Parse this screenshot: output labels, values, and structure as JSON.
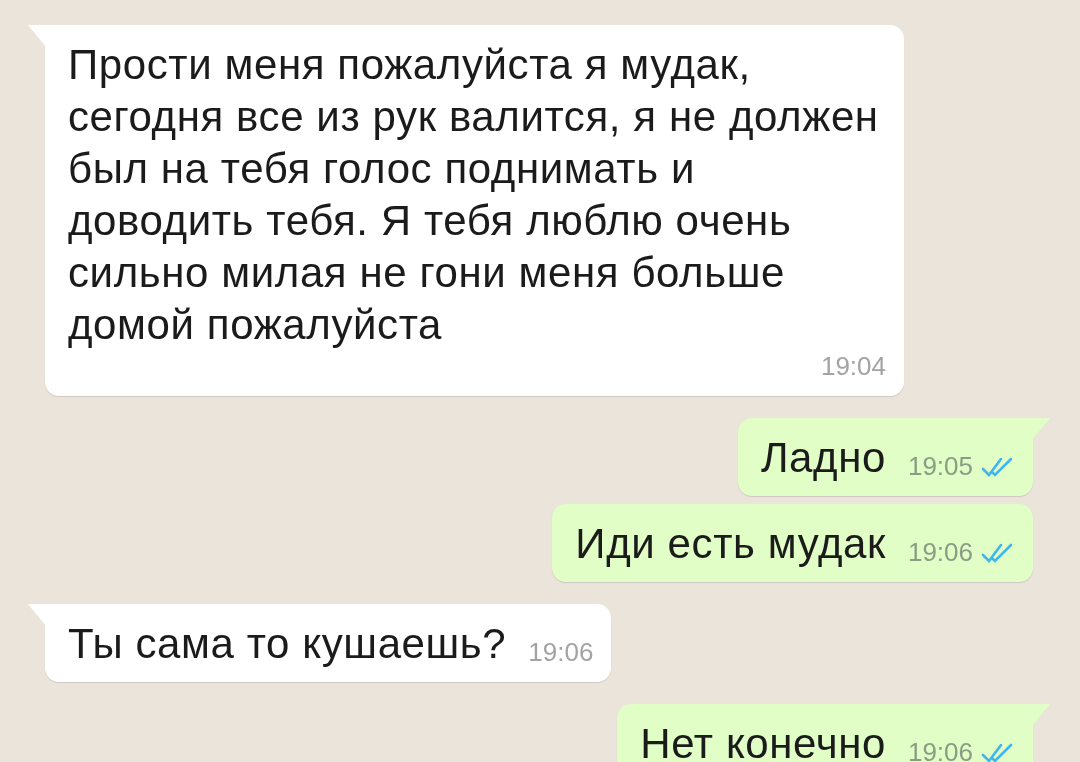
{
  "messages": [
    {
      "kind": "incoming",
      "text": "Прости меня пожалуйста я мудак, сегодня все из рук валится, я не должен был на тебя голос поднимать и доводить тебя. Я тебя люблю очень сильно милая не гони меня больше домой пожалуйста",
      "time": "19:04",
      "tail": true
    },
    {
      "kind": "outgoing",
      "text": "Ладно",
      "time": "19:05",
      "read": true,
      "tail": true
    },
    {
      "kind": "outgoing",
      "text": "Иди есть мудак",
      "time": "19:06",
      "read": true,
      "tail": false
    },
    {
      "kind": "incoming",
      "text": "Ты сама то кушаешь?",
      "time": "19:06",
      "tail": true
    },
    {
      "kind": "outgoing",
      "text": "Нет конечно",
      "time": "19:06",
      "read": true,
      "tail": true
    }
  ]
}
